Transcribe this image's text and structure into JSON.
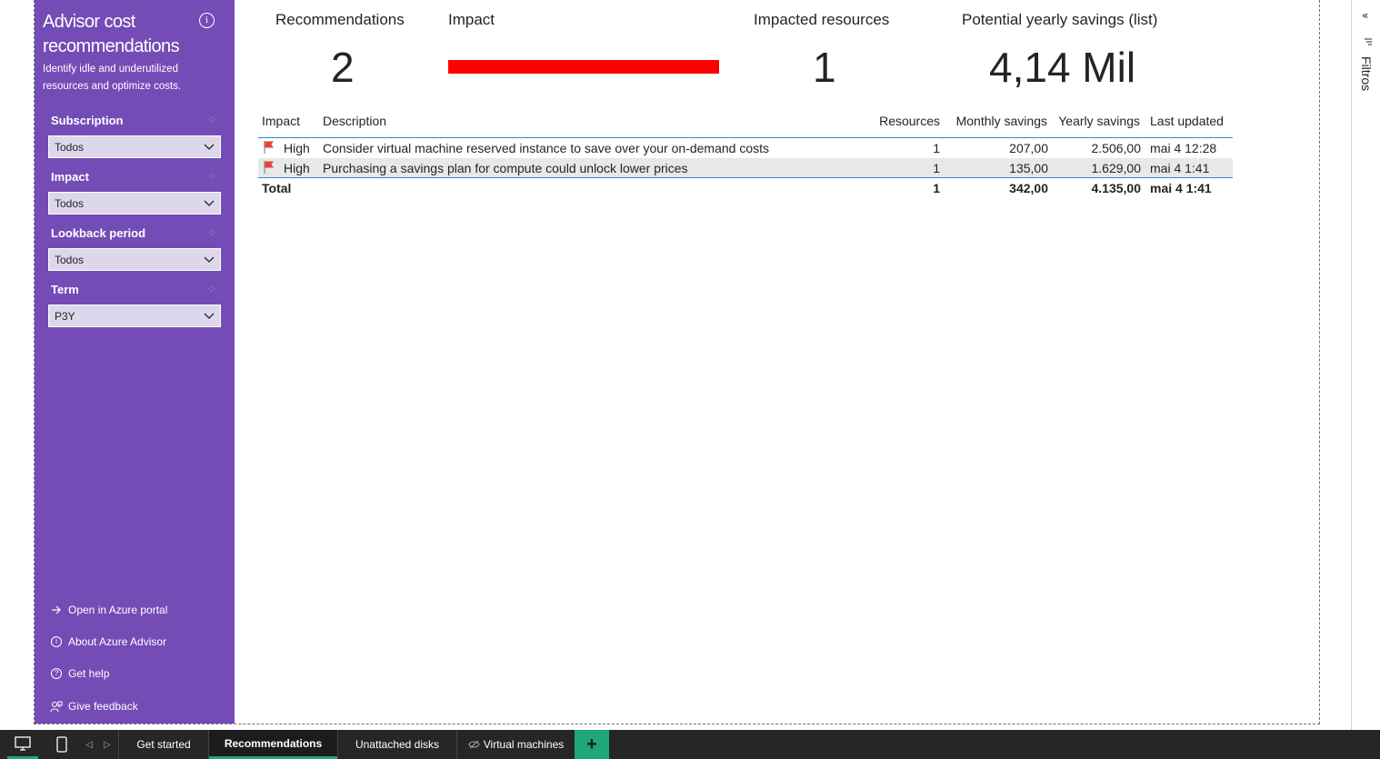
{
  "sidebar": {
    "title": "Advisor cost recommendations",
    "subtitle": "Identify idle and underutilized resources and optimize costs.",
    "info_icon": "info-icon",
    "slicers": [
      {
        "label": "Subscription",
        "value": "Todos"
      },
      {
        "label": "Impact",
        "value": "Todos"
      },
      {
        "label": "Lookback period",
        "value": "Todos"
      },
      {
        "label": "Term",
        "value": "P3Y"
      }
    ],
    "links": [
      {
        "label": "Open in Azure portal",
        "icon": "arrow-right-icon"
      },
      {
        "label": "About Azure Advisor",
        "icon": "info-icon"
      },
      {
        "label": "Get help",
        "icon": "question-icon"
      },
      {
        "label": "Give feedback",
        "icon": "feedback-icon"
      }
    ]
  },
  "kpis": {
    "recommendations": {
      "title": "Recommendations",
      "value": "2"
    },
    "impact": {
      "title": "Impact",
      "bar_color": "#ff0000"
    },
    "impacted_resources": {
      "title": "Impacted resources",
      "value": "1"
    },
    "yearly_savings": {
      "title": "Potential yearly savings (list)",
      "value": "4,14 Mil"
    }
  },
  "table": {
    "columns": [
      "Impact",
      "Description",
      "Resources",
      "Monthly savings",
      "Yearly savings",
      "Last updated"
    ],
    "rows": [
      {
        "impact": "High",
        "description": "Consider virtual machine reserved instance to save over your on-demand costs",
        "resources": "1",
        "monthly": "207,00",
        "yearly": "2.506,00",
        "updated": "mai 4 12:28"
      },
      {
        "impact": "High",
        "description": "Purchasing a savings plan for compute could unlock lower prices",
        "resources": "1",
        "monthly": "135,00",
        "yearly": "1.629,00",
        "updated": "mai 4 1:41"
      }
    ],
    "total": {
      "label": "Total",
      "resources": "1",
      "monthly": "342,00",
      "yearly": "4.135,00",
      "updated": "mai 4 1:41"
    }
  },
  "filter_pane": {
    "label": "Filtros"
  },
  "tabs": [
    {
      "label": "Get started",
      "active": false
    },
    {
      "label": "Recommendations",
      "active": true
    },
    {
      "label": "Unattached disks",
      "active": false
    },
    {
      "label": "Virtual machines",
      "active": false
    }
  ],
  "colors": {
    "sidebar": "#744cb6",
    "accent": "#1fa67a",
    "impact_high": "#ff0000"
  }
}
